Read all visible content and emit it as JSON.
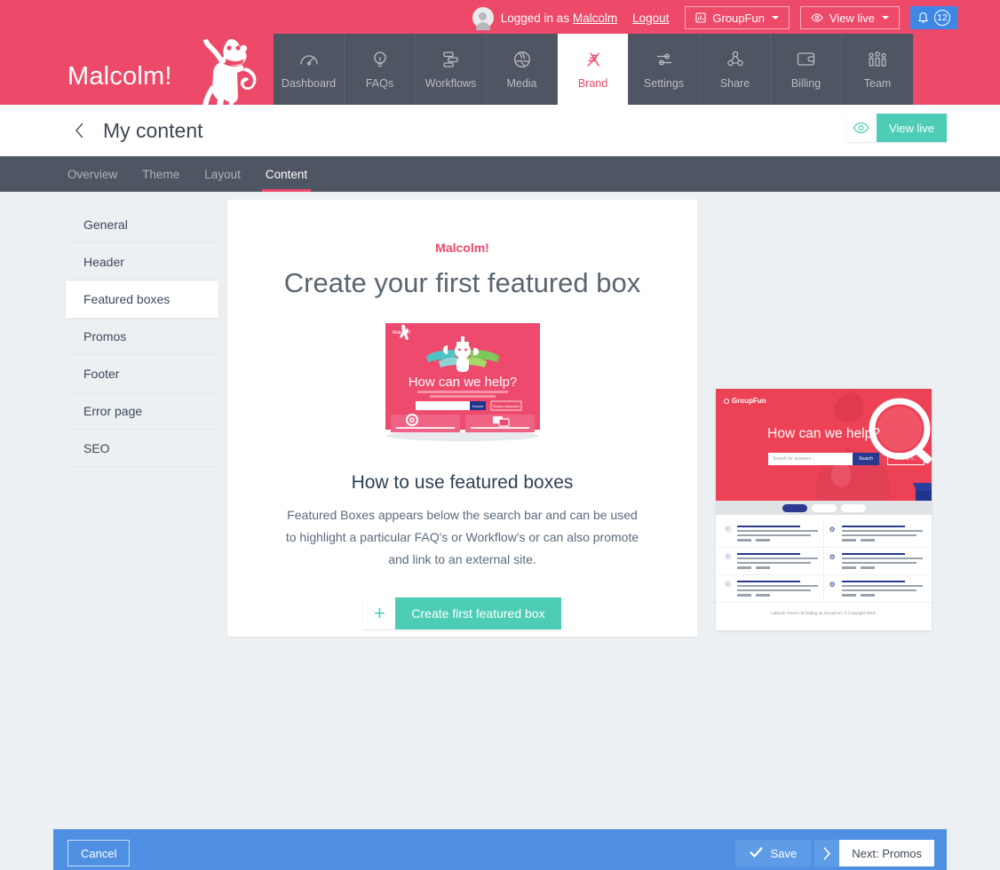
{
  "brand": {
    "logo_text": "Malcolm!",
    "pink": "#ed4969",
    "teal": "#4ecdb6",
    "blue": "#4f90e2",
    "dark": "#4f5562"
  },
  "account_bar": {
    "logged_in_prefix": "Logged in as ",
    "user_name": "Malcolm",
    "logout_label": "Logout",
    "workspace_label": "GroupFun",
    "workspace_icon": "bar-chart-icon",
    "view_live_label": "View live",
    "view_live_icon": "eye-icon",
    "bell_icon": "bell-icon",
    "notification_count": "12"
  },
  "main_nav": [
    {
      "label": "Dashboard",
      "icon": "gauge-icon",
      "active": false
    },
    {
      "label": "FAQs",
      "icon": "lightbulb-icon",
      "active": false
    },
    {
      "label": "Workflows",
      "icon": "flowchart-icon",
      "active": false
    },
    {
      "label": "Media",
      "icon": "aperture-icon",
      "active": false
    },
    {
      "label": "Brand",
      "icon": "dna-icon",
      "active": true
    },
    {
      "label": "Settings",
      "icon": "sliders-icon",
      "active": false
    },
    {
      "label": "Share",
      "icon": "share-nodes-icon",
      "active": false
    },
    {
      "label": "Billing",
      "icon": "wallet-icon",
      "active": false
    },
    {
      "label": "Team",
      "icon": "people-icon",
      "active": false
    }
  ],
  "page_header": {
    "back_icon": "chevron-left-icon",
    "title": "My content",
    "view_live_label": "View live",
    "view_live_icon": "eye-icon"
  },
  "sub_tabs": [
    {
      "label": "Overview",
      "active": false
    },
    {
      "label": "Theme",
      "active": false
    },
    {
      "label": "Layout",
      "active": false
    },
    {
      "label": "Content",
      "active": true
    }
  ],
  "sidebar": {
    "items": [
      {
        "label": "General",
        "active": false
      },
      {
        "label": "Header",
        "active": false
      },
      {
        "label": "Featured boxes",
        "active": true
      },
      {
        "label": "Promos",
        "active": false
      },
      {
        "label": "Footer",
        "active": false
      },
      {
        "label": "Error page",
        "active": false
      },
      {
        "label": "SEO",
        "active": false
      }
    ]
  },
  "card": {
    "brand_label": "Malcolm!",
    "heading": "Create your first featured box",
    "illustration_name": "help-center-preview-illustration",
    "subheading": "How to use featured boxes",
    "body": "Featured Boxes appears below the search bar and can be used to highlight a particular FAQ's or Workflow's or can also promote and link to an external site.",
    "cta_plus": "+",
    "cta_label": "Create first featured box"
  },
  "preview": {
    "logo_label": "GroupFun",
    "hero_title": "How can we help?",
    "search_placeholder": "Search for answers...",
    "search_button": "Search",
    "browse_button": "Browse c...",
    "footer_text": "Latitude Travel Ltd trading as GroupFun. © Copyright 2016.",
    "icon_left": "question-icon",
    "icon_right": "gear-icon"
  },
  "action_bar": {
    "cancel_label": "Cancel",
    "save_label": "Save",
    "save_icon": "check-icon",
    "next_label": "Next: Promos",
    "next_icon": "chevron-right-icon"
  }
}
